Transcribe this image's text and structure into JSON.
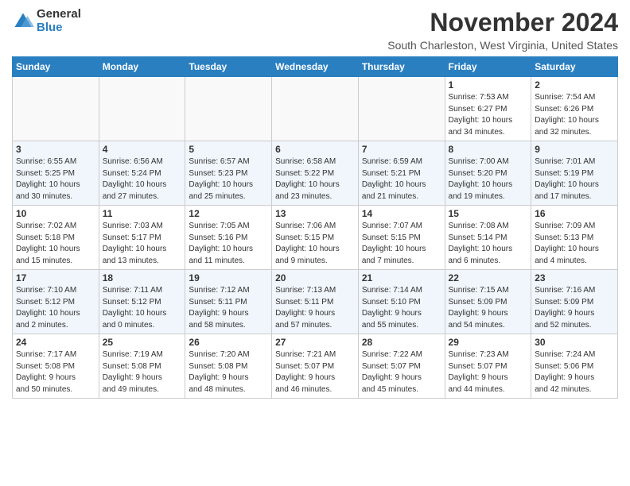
{
  "header": {
    "logo_general": "General",
    "logo_blue": "Blue",
    "month_title": "November 2024",
    "location": "South Charleston, West Virginia, United States"
  },
  "days_of_week": [
    "Sunday",
    "Monday",
    "Tuesday",
    "Wednesday",
    "Thursday",
    "Friday",
    "Saturday"
  ],
  "weeks": [
    [
      {
        "day": "",
        "info": ""
      },
      {
        "day": "",
        "info": ""
      },
      {
        "day": "",
        "info": ""
      },
      {
        "day": "",
        "info": ""
      },
      {
        "day": "",
        "info": ""
      },
      {
        "day": "1",
        "info": "Sunrise: 7:53 AM\nSunset: 6:27 PM\nDaylight: 10 hours\nand 34 minutes."
      },
      {
        "day": "2",
        "info": "Sunrise: 7:54 AM\nSunset: 6:26 PM\nDaylight: 10 hours\nand 32 minutes."
      }
    ],
    [
      {
        "day": "3",
        "info": "Sunrise: 6:55 AM\nSunset: 5:25 PM\nDaylight: 10 hours\nand 30 minutes."
      },
      {
        "day": "4",
        "info": "Sunrise: 6:56 AM\nSunset: 5:24 PM\nDaylight: 10 hours\nand 27 minutes."
      },
      {
        "day": "5",
        "info": "Sunrise: 6:57 AM\nSunset: 5:23 PM\nDaylight: 10 hours\nand 25 minutes."
      },
      {
        "day": "6",
        "info": "Sunrise: 6:58 AM\nSunset: 5:22 PM\nDaylight: 10 hours\nand 23 minutes."
      },
      {
        "day": "7",
        "info": "Sunrise: 6:59 AM\nSunset: 5:21 PM\nDaylight: 10 hours\nand 21 minutes."
      },
      {
        "day": "8",
        "info": "Sunrise: 7:00 AM\nSunset: 5:20 PM\nDaylight: 10 hours\nand 19 minutes."
      },
      {
        "day": "9",
        "info": "Sunrise: 7:01 AM\nSunset: 5:19 PM\nDaylight: 10 hours\nand 17 minutes."
      }
    ],
    [
      {
        "day": "10",
        "info": "Sunrise: 7:02 AM\nSunset: 5:18 PM\nDaylight: 10 hours\nand 15 minutes."
      },
      {
        "day": "11",
        "info": "Sunrise: 7:03 AM\nSunset: 5:17 PM\nDaylight: 10 hours\nand 13 minutes."
      },
      {
        "day": "12",
        "info": "Sunrise: 7:05 AM\nSunset: 5:16 PM\nDaylight: 10 hours\nand 11 minutes."
      },
      {
        "day": "13",
        "info": "Sunrise: 7:06 AM\nSunset: 5:15 PM\nDaylight: 10 hours\nand 9 minutes."
      },
      {
        "day": "14",
        "info": "Sunrise: 7:07 AM\nSunset: 5:15 PM\nDaylight: 10 hours\nand 7 minutes."
      },
      {
        "day": "15",
        "info": "Sunrise: 7:08 AM\nSunset: 5:14 PM\nDaylight: 10 hours\nand 6 minutes."
      },
      {
        "day": "16",
        "info": "Sunrise: 7:09 AM\nSunset: 5:13 PM\nDaylight: 10 hours\nand 4 minutes."
      }
    ],
    [
      {
        "day": "17",
        "info": "Sunrise: 7:10 AM\nSunset: 5:12 PM\nDaylight: 10 hours\nand 2 minutes."
      },
      {
        "day": "18",
        "info": "Sunrise: 7:11 AM\nSunset: 5:12 PM\nDaylight: 10 hours\nand 0 minutes."
      },
      {
        "day": "19",
        "info": "Sunrise: 7:12 AM\nSunset: 5:11 PM\nDaylight: 9 hours\nand 58 minutes."
      },
      {
        "day": "20",
        "info": "Sunrise: 7:13 AM\nSunset: 5:11 PM\nDaylight: 9 hours\nand 57 minutes."
      },
      {
        "day": "21",
        "info": "Sunrise: 7:14 AM\nSunset: 5:10 PM\nDaylight: 9 hours\nand 55 minutes."
      },
      {
        "day": "22",
        "info": "Sunrise: 7:15 AM\nSunset: 5:09 PM\nDaylight: 9 hours\nand 54 minutes."
      },
      {
        "day": "23",
        "info": "Sunrise: 7:16 AM\nSunset: 5:09 PM\nDaylight: 9 hours\nand 52 minutes."
      }
    ],
    [
      {
        "day": "24",
        "info": "Sunrise: 7:17 AM\nSunset: 5:08 PM\nDaylight: 9 hours\nand 50 minutes."
      },
      {
        "day": "25",
        "info": "Sunrise: 7:19 AM\nSunset: 5:08 PM\nDaylight: 9 hours\nand 49 minutes."
      },
      {
        "day": "26",
        "info": "Sunrise: 7:20 AM\nSunset: 5:08 PM\nDaylight: 9 hours\nand 48 minutes."
      },
      {
        "day": "27",
        "info": "Sunrise: 7:21 AM\nSunset: 5:07 PM\nDaylight: 9 hours\nand 46 minutes."
      },
      {
        "day": "28",
        "info": "Sunrise: 7:22 AM\nSunset: 5:07 PM\nDaylight: 9 hours\nand 45 minutes."
      },
      {
        "day": "29",
        "info": "Sunrise: 7:23 AM\nSunset: 5:07 PM\nDaylight: 9 hours\nand 44 minutes."
      },
      {
        "day": "30",
        "info": "Sunrise: 7:24 AM\nSunset: 5:06 PM\nDaylight: 9 hours\nand 42 minutes."
      }
    ]
  ]
}
